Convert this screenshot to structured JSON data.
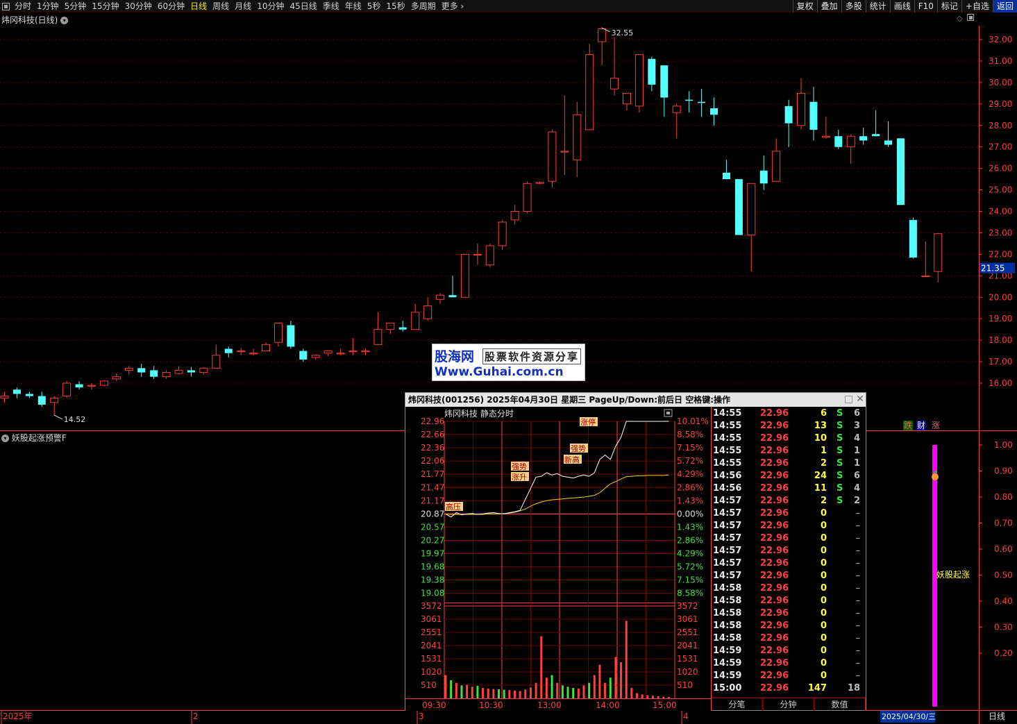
{
  "toolbar": {
    "left_items": [
      "分时",
      "1分钟",
      "5分钟",
      "15分钟",
      "30分钟",
      "60分钟",
      "日线",
      "周线",
      "月线",
      "10分钟",
      "45日线",
      "季线",
      "年线",
      "5秒",
      "15秒",
      "多周期",
      "更多"
    ],
    "active_item": "日线",
    "right_items": [
      "复权",
      "叠加",
      "多股",
      "统计",
      "画线",
      "F10",
      "标记",
      "+自选",
      "返回"
    ],
    "selected_right_item": "返回",
    "more_icon": "chevron-right-icon",
    "panel_icon": "layout-icon"
  },
  "kline": {
    "title": "炜冈科技(日线)",
    "price_axis": [
      "32.00",
      "31.00",
      "30.00",
      "29.00",
      "28.00",
      "27.00",
      "26.00",
      "25.00",
      "24.00",
      "23.00",
      "22.00",
      "21.00",
      "20.00",
      "19.00",
      "18.00",
      "17.00",
      "16.00"
    ],
    "ylim": [
      15.0,
      33.0
    ],
    "high_label": "32.55",
    "low_label": "14.52",
    "current_price_label": "21.35",
    "colors": {
      "up": "#ff3b3b",
      "down": "#54ffff",
      "grid": "#5a0000",
      "axis": "#ff3b3b",
      "current": "#0030a0"
    },
    "candles": [
      {
        "o": 15.3,
        "h": 15.6,
        "l": 15.1,
        "c": 15.4
      },
      {
        "o": 15.7,
        "h": 15.8,
        "l": 15.3,
        "c": 15.5
      },
      {
        "o": 15.5,
        "h": 15.6,
        "l": 15.3,
        "c": 15.4
      },
      {
        "o": 15.4,
        "h": 15.6,
        "l": 14.9,
        "c": 15.0
      },
      {
        "o": 15.1,
        "h": 15.4,
        "l": 14.52,
        "c": 15.3
      },
      {
        "o": 15.4,
        "h": 16.1,
        "l": 15.3,
        "c": 16.0
      },
      {
        "o": 15.95,
        "h": 16.1,
        "l": 15.7,
        "c": 15.8
      },
      {
        "o": 15.9,
        "h": 16.0,
        "l": 15.7,
        "c": 15.9
      },
      {
        "o": 15.9,
        "h": 16.15,
        "l": 15.85,
        "c": 16.1
      },
      {
        "o": 16.2,
        "h": 16.45,
        "l": 16.1,
        "c": 16.3
      },
      {
        "o": 16.6,
        "h": 16.8,
        "l": 16.4,
        "c": 16.7
      },
      {
        "o": 16.7,
        "h": 16.9,
        "l": 16.3,
        "c": 16.5
      },
      {
        "o": 16.6,
        "h": 16.8,
        "l": 16.2,
        "c": 16.3
      },
      {
        "o": 16.3,
        "h": 16.6,
        "l": 16.2,
        "c": 16.5
      },
      {
        "o": 16.45,
        "h": 16.8,
        "l": 16.4,
        "c": 16.6
      },
      {
        "o": 16.6,
        "h": 16.75,
        "l": 16.3,
        "c": 16.5
      },
      {
        "o": 16.5,
        "h": 16.75,
        "l": 16.4,
        "c": 16.7
      },
      {
        "o": 16.7,
        "h": 17.8,
        "l": 16.7,
        "c": 17.3
      },
      {
        "o": 17.6,
        "h": 17.7,
        "l": 17.2,
        "c": 17.4
      },
      {
        "o": 17.5,
        "h": 17.65,
        "l": 17.3,
        "c": 17.5
      },
      {
        "o": 17.4,
        "h": 17.6,
        "l": 17.3,
        "c": 17.4
      },
      {
        "o": 17.5,
        "h": 17.9,
        "l": 17.5,
        "c": 17.8
      },
      {
        "o": 17.9,
        "h": 18.8,
        "l": 17.7,
        "c": 18.8
      },
      {
        "o": 18.7,
        "h": 18.9,
        "l": 17.6,
        "c": 17.7
      },
      {
        "o": 17.5,
        "h": 17.6,
        "l": 17.0,
        "c": 17.1
      },
      {
        "o": 17.2,
        "h": 17.35,
        "l": 17.1,
        "c": 17.3
      },
      {
        "o": 17.4,
        "h": 17.5,
        "l": 17.25,
        "c": 17.5
      },
      {
        "o": 17.4,
        "h": 17.6,
        "l": 17.3,
        "c": 17.4
      },
      {
        "o": 17.5,
        "h": 18.1,
        "l": 17.3,
        "c": 17.5
      },
      {
        "o": 17.5,
        "h": 17.6,
        "l": 17.3,
        "c": 17.5
      },
      {
        "o": 17.8,
        "h": 19.3,
        "l": 17.8,
        "c": 18.5
      },
      {
        "o": 18.5,
        "h": 18.8,
        "l": 18.3,
        "c": 18.8
      },
      {
        "o": 18.6,
        "h": 18.9,
        "l": 18.4,
        "c": 18.5
      },
      {
        "o": 18.5,
        "h": 19.7,
        "l": 18.5,
        "c": 19.3
      },
      {
        "o": 19.0,
        "h": 20.0,
        "l": 18.9,
        "c": 19.6
      },
      {
        "o": 19.9,
        "h": 20.2,
        "l": 19.7,
        "c": 20.1
      },
      {
        "o": 20.1,
        "h": 21.0,
        "l": 20.0,
        "c": 20.0
      },
      {
        "o": 20.0,
        "h": 22.0,
        "l": 20.0,
        "c": 22.0
      },
      {
        "o": 22.0,
        "h": 22.5,
        "l": 21.5,
        "c": 22.0
      },
      {
        "o": 21.5,
        "h": 22.5,
        "l": 21.4,
        "c": 22.4
      },
      {
        "o": 22.4,
        "h": 23.6,
        "l": 22.2,
        "c": 23.5
      },
      {
        "o": 23.6,
        "h": 24.3,
        "l": 23.4,
        "c": 24.0
      },
      {
        "o": 24.0,
        "h": 25.4,
        "l": 23.9,
        "c": 25.3
      },
      {
        "o": 25.3,
        "h": 25.4,
        "l": 25.25,
        "c": 25.35
      },
      {
        "o": 25.4,
        "h": 27.8,
        "l": 25.1,
        "c": 27.7
      },
      {
        "o": 26.8,
        "h": 29.4,
        "l": 25.7,
        "c": 26.8
      },
      {
        "o": 26.4,
        "h": 29.1,
        "l": 25.6,
        "c": 28.5
      },
      {
        "o": 27.8,
        "h": 31.8,
        "l": 27.8,
        "c": 31.3
      },
      {
        "o": 31.9,
        "h": 32.55,
        "l": 30.8,
        "c": 32.5
      },
      {
        "o": 29.7,
        "h": 32.1,
        "l": 29.4,
        "c": 30.2
      },
      {
        "o": 29.0,
        "h": 29.5,
        "l": 28.7,
        "c": 29.5
      },
      {
        "o": 28.9,
        "h": 31.3,
        "l": 28.6,
        "c": 31.3
      },
      {
        "o": 31.1,
        "h": 31.2,
        "l": 29.6,
        "c": 29.9
      },
      {
        "o": 30.8,
        "h": 30.8,
        "l": 28.4,
        "c": 29.3
      },
      {
        "o": 28.6,
        "h": 29.0,
        "l": 27.4,
        "c": 28.9
      },
      {
        "o": 29.2,
        "h": 29.6,
        "l": 28.6,
        "c": 29.15
      },
      {
        "o": 29.1,
        "h": 29.7,
        "l": 28.4,
        "c": 29.05
      },
      {
        "o": 28.8,
        "h": 29.3,
        "l": 28.0,
        "c": 28.5
      },
      {
        "o": 25.8,
        "h": 26.4,
        "l": 25.8,
        "c": 25.5
      },
      {
        "o": 25.5,
        "h": 25.5,
        "l": 22.9,
        "c": 22.9
      },
      {
        "o": 22.9,
        "h": 25.3,
        "l": 21.2,
        "c": 25.3
      },
      {
        "o": 25.9,
        "h": 26.6,
        "l": 25.0,
        "c": 25.3
      },
      {
        "o": 25.4,
        "h": 27.4,
        "l": 25.4,
        "c": 26.8
      },
      {
        "o": 28.9,
        "h": 29.2,
        "l": 27.0,
        "c": 28.1
      },
      {
        "o": 28.0,
        "h": 30.2,
        "l": 27.8,
        "c": 29.5
      },
      {
        "o": 29.1,
        "h": 29.8,
        "l": 27.3,
        "c": 27.8
      },
      {
        "o": 27.45,
        "h": 28.4,
        "l": 27.4,
        "c": 27.5
      },
      {
        "o": 27.5,
        "h": 27.8,
        "l": 26.9,
        "c": 27.0
      },
      {
        "o": 27.0,
        "h": 27.6,
        "l": 26.2,
        "c": 27.5
      },
      {
        "o": 27.5,
        "h": 27.9,
        "l": 27.1,
        "c": 27.3
      },
      {
        "o": 27.6,
        "h": 28.7,
        "l": 27.5,
        "c": 27.5
      },
      {
        "o": 27.3,
        "h": 28.2,
        "l": 27.0,
        "c": 27.1
      },
      {
        "o": 27.4,
        "h": 27.4,
        "l": 24.3,
        "c": 24.3
      },
      {
        "o": 23.6,
        "h": 23.7,
        "l": 21.8,
        "c": 21.85
      },
      {
        "o": 21.0,
        "h": 22.6,
        "l": 20.95,
        "c": 21.0
      },
      {
        "o": 21.2,
        "h": 22.9,
        "l": 20.7,
        "c": 22.96
      }
    ],
    "date_labels": [
      "2025年",
      "2",
      "3",
      "4"
    ],
    "cursor_date": "2025/04/30/三",
    "period_label": "日线",
    "signal_labels": [
      "跌",
      "财",
      "涨"
    ]
  },
  "indicator": {
    "title": "妖股起涨预警F",
    "axis": [
      "1.00",
      "0.90",
      "0.80",
      "0.70",
      "0.60",
      "0.50",
      "0.40",
      "0.30",
      "0.20"
    ],
    "signal_text": "妖股起涨",
    "bar_value": 1.0,
    "bar_color": "#ff00ff",
    "marker_icon": "peach-icon"
  },
  "popup": {
    "title": "炜冈科技(001256)  2025年04月30日  星期三  PageUp/Down:前后日  空格键:操作",
    "chart_title": "炜冈科技   静态分时",
    "price_ticks": [
      "22.96",
      "22.66",
      "22.36",
      "22.06",
      "21.77",
      "21.47",
      "21.17",
      "20.87",
      "20.57",
      "20.27",
      "19.97",
      "19.68",
      "19.38",
      "19.08"
    ],
    "pct_ticks": [
      "10.01%",
      "8.58%",
      "7.15%",
      "5.72%",
      "4.29%",
      "2.86%",
      "1.43%",
      "0.00%",
      "1.43%",
      "2.86%",
      "4.29%",
      "5.72%",
      "7.15%",
      "8.58%"
    ],
    "vol_ticks": [
      "3572",
      "3061",
      "2551",
      "2041",
      "1531",
      "1020",
      "510"
    ],
    "time_ticks": [
      "09:30",
      "10:30",
      "13:00",
      "14:00",
      "15:00"
    ],
    "annotations": [
      "高压",
      "强势",
      "涨升",
      "强势",
      "新高",
      "涨停"
    ],
    "chart_data": {
      "type": "line",
      "prev_close": 20.87,
      "ylim": [
        19.08,
        22.96
      ],
      "price": [
        20.87,
        20.8,
        20.9,
        20.85,
        20.87,
        20.88,
        20.86,
        20.87,
        20.89,
        20.9,
        20.88,
        20.87,
        20.9,
        20.92,
        20.95,
        21.2,
        21.45,
        21.7,
        21.72,
        21.8,
        21.75,
        21.78,
        21.72,
        21.7,
        21.68,
        21.72,
        21.75,
        21.72,
        21.8,
        22.1,
        22.2,
        22.1,
        22.4,
        22.6,
        22.96,
        22.96,
        22.96,
        22.96,
        22.96,
        22.96,
        22.96,
        22.96,
        22.96
      ],
      "avg": [
        20.87,
        20.86,
        20.86,
        20.86,
        20.86,
        20.86,
        20.86,
        20.86,
        20.87,
        20.87,
        20.87,
        20.88,
        20.89,
        20.91,
        20.94,
        20.98,
        21.05,
        21.1,
        21.14,
        21.17,
        21.19,
        21.2,
        21.21,
        21.22,
        21.23,
        21.24,
        21.25,
        21.27,
        21.29,
        21.35,
        21.45,
        21.55,
        21.6,
        21.66,
        21.71,
        21.72,
        21.73,
        21.73,
        21.74,
        21.74,
        21.74,
        21.74,
        21.75
      ],
      "volume": [
        900,
        700,
        600,
        500,
        520,
        450,
        480,
        400,
        380,
        360,
        350,
        330,
        320,
        300,
        280,
        340,
        420,
        600,
        2400,
        800,
        900,
        600,
        500,
        450,
        400,
        380,
        500,
        600,
        900,
        1300,
        600,
        800,
        1600,
        1400,
        3000,
        400,
        200,
        150,
        120,
        100,
        80,
        60,
        50
      ]
    },
    "ticks": [
      {
        "time": "14:55",
        "price": "22.96",
        "vol": "6",
        "side": "S",
        "num": "6"
      },
      {
        "time": "14:55",
        "price": "22.96",
        "vol": "13",
        "side": "S",
        "num": "3"
      },
      {
        "time": "14:55",
        "price": "22.96",
        "vol": "10",
        "side": "S",
        "num": "4"
      },
      {
        "time": "14:55",
        "price": "22.96",
        "vol": "1",
        "side": "S",
        "num": "1"
      },
      {
        "time": "14:55",
        "price": "22.96",
        "vol": "2",
        "side": "S",
        "num": "1"
      },
      {
        "time": "14:56",
        "price": "22.96",
        "vol": "24",
        "side": "S",
        "num": "6"
      },
      {
        "time": "14:56",
        "price": "22.96",
        "vol": "11",
        "side": "S",
        "num": "4"
      },
      {
        "time": "14:57",
        "price": "22.96",
        "vol": "2",
        "side": "S",
        "num": "2"
      },
      {
        "time": "14:57",
        "price": "22.96",
        "vol": "0",
        "side": "",
        "num": "–"
      },
      {
        "time": "14:57",
        "price": "22.96",
        "vol": "0",
        "side": "",
        "num": "–"
      },
      {
        "time": "14:57",
        "price": "22.96",
        "vol": "0",
        "side": "",
        "num": "–"
      },
      {
        "time": "14:57",
        "price": "22.96",
        "vol": "0",
        "side": "",
        "num": "–"
      },
      {
        "time": "14:57",
        "price": "22.96",
        "vol": "0",
        "side": "",
        "num": "–"
      },
      {
        "time": "14:57",
        "price": "22.96",
        "vol": "0",
        "side": "",
        "num": "–"
      },
      {
        "time": "14:58",
        "price": "22.96",
        "vol": "0",
        "side": "",
        "num": "–"
      },
      {
        "time": "14:58",
        "price": "22.96",
        "vol": "0",
        "side": "",
        "num": "–"
      },
      {
        "time": "14:58",
        "price": "22.96",
        "vol": "0",
        "side": "",
        "num": "–"
      },
      {
        "time": "14:58",
        "price": "22.96",
        "vol": "0",
        "side": "",
        "num": "–"
      },
      {
        "time": "14:58",
        "price": "22.96",
        "vol": "0",
        "side": "",
        "num": "–"
      },
      {
        "time": "14:59",
        "price": "22.96",
        "vol": "0",
        "side": "",
        "num": "–"
      },
      {
        "time": "14:59",
        "price": "22.96",
        "vol": "0",
        "side": "",
        "num": "–"
      },
      {
        "time": "14:59",
        "price": "22.96",
        "vol": "0",
        "side": "",
        "num": "–"
      },
      {
        "time": "15:00",
        "price": "22.96",
        "vol": "147",
        "side": "",
        "num": "18"
      }
    ],
    "tabs": [
      "分笔",
      "分钟",
      "数值"
    ]
  },
  "watermark": {
    "brand": "股海网",
    "slogan": "股票软件资源分享",
    "url": "Www.Guhai.com.cn"
  }
}
